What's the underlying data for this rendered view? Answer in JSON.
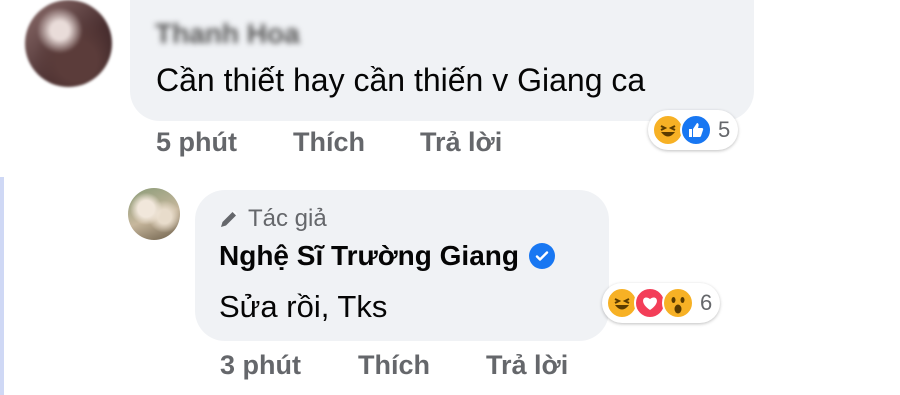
{
  "comment": {
    "author": "Thanh Hoa",
    "text": "Cần thiết hay cần thiến v Giang ca",
    "time": "5 phút",
    "like_label": "Thích",
    "reply_label": "Trả lời",
    "reaction_count": "5",
    "reactions": [
      "haha",
      "like"
    ]
  },
  "reply": {
    "badge_label": "Tác giả",
    "author": "Nghệ Sĩ Trường Giang",
    "text": "Sửa rồi, Tks",
    "time": "3 phút",
    "like_label": "Thích",
    "reply_label": "Trả lời",
    "reaction_count": "6",
    "reactions": [
      "haha",
      "love",
      "wow"
    ]
  },
  "colors": {
    "bubble": "#f0f2f5",
    "meta_text": "#65676b",
    "like_blue": "#1877f2",
    "love_red": "#f33e58",
    "emoji_yellow": "#f7b125",
    "thread_line": "#cfd8f5"
  }
}
